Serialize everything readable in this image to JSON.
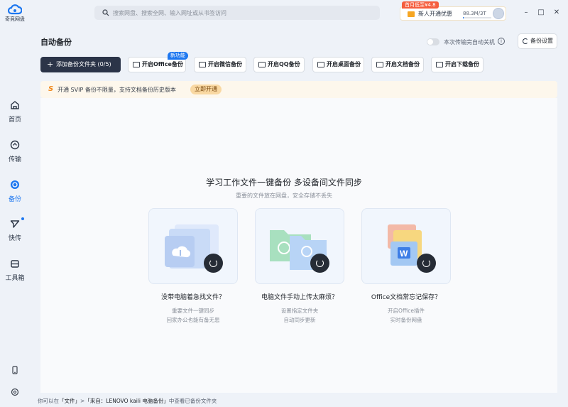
{
  "app": {
    "name": "奇竞网盘"
  },
  "search": {
    "placeholder": "搜索网盘、搜索全网、输入网址或从书签访问"
  },
  "promo": {
    "tag": "首月低至¥4.8",
    "label": "新人开通优惠",
    "quota": "88.3M/3T",
    "quota_fraction": 0.01
  },
  "sidebar": {
    "items": [
      {
        "label": "首页",
        "icon": "home-icon"
      },
      {
        "label": "传输",
        "icon": "transfer-icon"
      },
      {
        "label": "备份",
        "icon": "backup-icon",
        "active": true
      },
      {
        "label": "快传",
        "icon": "send-icon",
        "dot": true
      },
      {
        "label": "工具箱",
        "icon": "toolbox-icon"
      }
    ]
  },
  "page": {
    "title": "自动备份",
    "shutdown_toggle_label": "本次传输完自动关机",
    "settings_button": "备份设置"
  },
  "toolbar": {
    "add_folder": "添加备份文件夹 (0/5)",
    "new_badge": "新功能",
    "buttons": [
      "开启Office备份",
      "开启微信备份",
      "开启QQ备份",
      "开启桌面备份",
      "开启文档备份",
      "开启下载备份"
    ]
  },
  "notice": {
    "brand": "S",
    "text": "开通 SVIP 备份不限量，支持文档备份历史版本",
    "cta": "立即开通"
  },
  "hero": {
    "title": "学习工作文件一键备份 多设备间文件同步",
    "subtitle": "重要的文件放在网盘，安全存储不丢失"
  },
  "cards": [
    {
      "title": "没带电脑着急找文件？",
      "line1": "重要文件一键同步",
      "line2": "回家办公也能有备无患"
    },
    {
      "title": "电脑文件手动上传太麻烦？",
      "line1": "设置指定文件夹",
      "line2": "自动同步更新"
    },
    {
      "title": "Office文档常忘记保存？",
      "line1": "开启Office插件",
      "line2": "实时备份网盘"
    }
  ],
  "footer": {
    "prefix": "你可以在",
    "link1": "「文件」",
    "mid": ">",
    "link2": "「来自：LENOVO kaili 电脑备份」",
    "suffix": "中查看已备份文件夹"
  },
  "colors": {
    "accent": "#1d77f0",
    "dark_button": "#2b3448",
    "notice_bg": "#fdf7ec"
  }
}
